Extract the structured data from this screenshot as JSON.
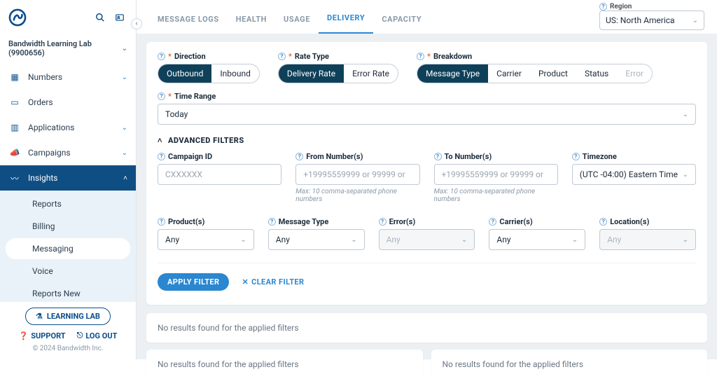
{
  "account": {
    "name": "Bandwidth Learning Lab (9900656)"
  },
  "sidebar": {
    "numbers": "Numbers",
    "orders": "Orders",
    "applications": "Applications",
    "campaigns": "Campaigns",
    "insights": "Insights",
    "insights_children": {
      "reports": "Reports",
      "billing": "Billing",
      "messaging": "Messaging",
      "voice": "Voice",
      "reports_new": "Reports New"
    },
    "learning_lab": "LEARNING LAB",
    "support": "SUPPORT",
    "logout": "LOG OUT",
    "copyright": "© 2024 Bandwidth Inc."
  },
  "tabs": {
    "message_logs": "MESSAGE LOGS",
    "health": "HEALTH",
    "usage": "USAGE",
    "delivery": "DELIVERY",
    "capacity": "CAPACITY"
  },
  "region": {
    "label": "Region",
    "value": "US: North America"
  },
  "filters": {
    "direction": {
      "label": "Direction",
      "opts": {
        "outbound": "Outbound",
        "inbound": "Inbound"
      }
    },
    "rate_type": {
      "label": "Rate Type",
      "opts": {
        "delivery": "Delivery Rate",
        "error": "Error Rate"
      }
    },
    "breakdown": {
      "label": "Breakdown",
      "opts": {
        "msgtype": "Message Type",
        "carrier": "Carrier",
        "product": "Product",
        "status": "Status",
        "error": "Error"
      }
    },
    "time_range": {
      "label": "Time Range",
      "value": "Today"
    },
    "advanced": {
      "heading": "ADVANCED FILTERS",
      "campaign_id": {
        "label": "Campaign ID",
        "placeholder": "CXXXXXX"
      },
      "from_numbers": {
        "label": "From Number(s)",
        "placeholder": "+19995559999 or 99999 or",
        "hint": "Max: 10 comma-separated phone numbers"
      },
      "to_numbers": {
        "label": "To Number(s)",
        "placeholder": "+19995559999 or 99999 or",
        "hint": "Max: 10 comma-separated phone numbers"
      },
      "timezone": {
        "label": "Timezone",
        "value": "(UTC -04:00) Eastern Time"
      },
      "products": {
        "label": "Product(s)",
        "value": "Any"
      },
      "message_type": {
        "label": "Message Type",
        "value": "Any"
      },
      "errors": {
        "label": "Error(s)",
        "value": "Any"
      },
      "carriers": {
        "label": "Carrier(s)",
        "value": "Any"
      },
      "locations": {
        "label": "Location(s)",
        "value": "Any"
      }
    },
    "apply": "APPLY FILTER",
    "clear": "CLEAR FILTER"
  },
  "results": {
    "empty": "No results found for the applied filters"
  }
}
